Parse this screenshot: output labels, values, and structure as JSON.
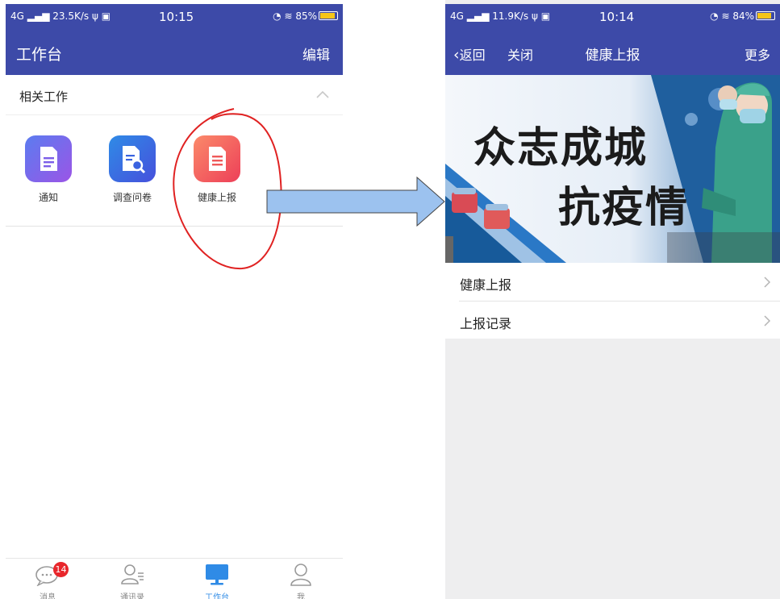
{
  "left": {
    "status": {
      "network": "4G",
      "speed": "23.5K/s",
      "time": "10:15",
      "battery": "85%"
    },
    "header": {
      "title": "工作台",
      "edit_label": "编辑"
    },
    "section": {
      "title": "相关工作"
    },
    "apps": [
      {
        "label": "通知",
        "color": "#7b5ee8",
        "icon": "document-icon"
      },
      {
        "label": "调查问卷",
        "color": "#3a63e0",
        "icon": "survey-search-icon"
      },
      {
        "label": "健康上报",
        "color": "#f0565a",
        "icon": "report-icon"
      }
    ],
    "tabs": [
      {
        "label": "消息",
        "badge": "14",
        "icon": "chat-icon"
      },
      {
        "label": "通讯录",
        "icon": "contacts-icon"
      },
      {
        "label": "工作台",
        "icon": "monitor-icon",
        "active": true
      },
      {
        "label": "我",
        "icon": "person-icon"
      }
    ],
    "accent": "#3d4aa8"
  },
  "right": {
    "status": {
      "network": "4G",
      "speed": "11.9K/s",
      "time": "10:14",
      "battery": "84%"
    },
    "header": {
      "back_label": "返回",
      "close_label": "关闭",
      "title": "健康上报",
      "more_label": "更多"
    },
    "banner": {
      "line1": "众志成城",
      "line2": "抗疫情"
    },
    "list": [
      {
        "label": "健康上报"
      },
      {
        "label": "上报记录"
      }
    ]
  },
  "annotation": {
    "circle_color": "#e02222",
    "arrow_color": "#9cc2ef"
  }
}
